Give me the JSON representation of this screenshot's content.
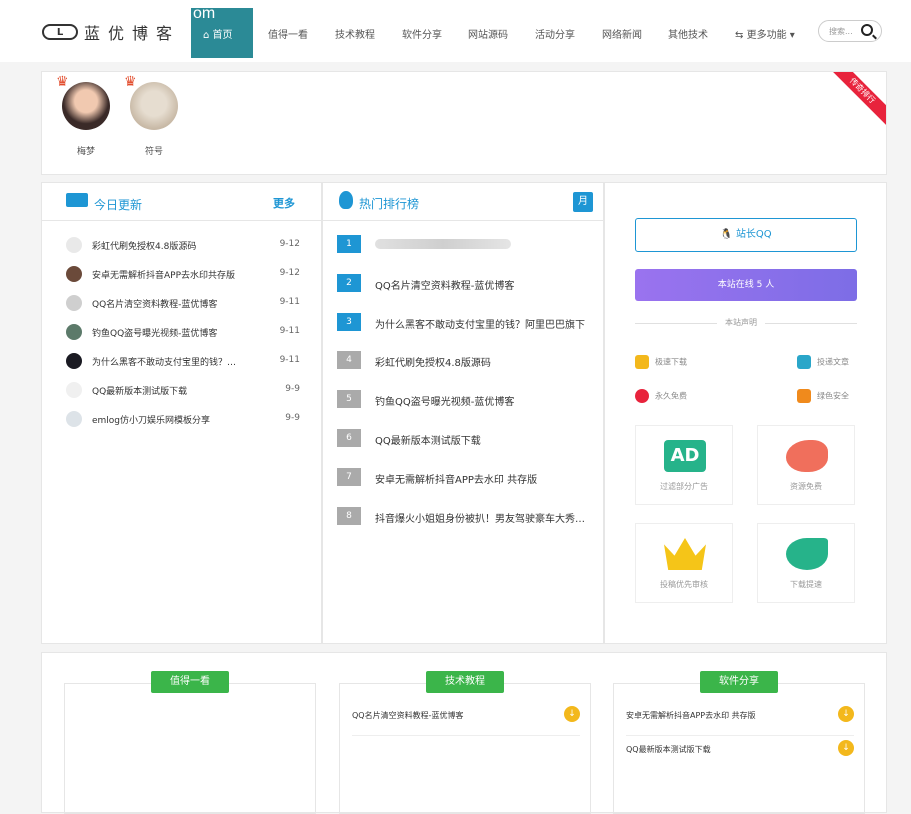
{
  "brand": {
    "mark": "L",
    "name": "蓝优博客",
    "om": "om"
  },
  "nav": {
    "home": "首页",
    "items": [
      "值得一看",
      "技术教程",
      "软件分享",
      "网站源码",
      "活动分享",
      "网络新闻",
      "其他技术",
      "更多功能"
    ],
    "search_placeholder": "搜索..."
  },
  "users": {
    "ribbon": "传奇排行",
    "list": [
      {
        "name": "梅梦"
      },
      {
        "name": "符号"
      }
    ]
  },
  "today": {
    "title": "今日更新",
    "more": "更多",
    "items": [
      {
        "title": "彩虹代刷免授权4.8版源码",
        "date": "9-12"
      },
      {
        "title": "安卓无需解析抖音APP去水印共存版",
        "date": "9-12"
      },
      {
        "title": "QQ名片清空资料教程-蓝优博客",
        "date": "9-11"
      },
      {
        "title": "钓鱼QQ盗号曝光视频-蓝优博客",
        "date": "9-11"
      },
      {
        "title": "为什么黑客不敢动支付宝里的钱？阿里巴巴",
        "date": "9-11"
      },
      {
        "title": "QQ最新版本测试版下载",
        "date": "9-9"
      },
      {
        "title": "emlog仿小刀娱乐网模板分享",
        "date": "9-9"
      }
    ]
  },
  "hot": {
    "title": "热门排行榜",
    "period": "月",
    "items": [
      {
        "rank": "1",
        "title": ""
      },
      {
        "rank": "2",
        "title": "QQ名片清空资料教程-蓝优博客"
      },
      {
        "rank": "3",
        "title": "为什么黑客不敢动支付宝里的钱？阿里巴巴旗下"
      },
      {
        "rank": "4",
        "title": "彩虹代刷免授权4.8版源码"
      },
      {
        "rank": "5",
        "title": "钓鱼QQ盗号曝光视频-蓝优博客"
      },
      {
        "rank": "6",
        "title": "QQ最新版本测试版下载"
      },
      {
        "rank": "7",
        "title": "安卓无需解析抖音APP去水印 共存版"
      },
      {
        "rank": "8",
        "title": "抖音爆火小姐姐身份被扒！男友驾驶豪车大秀恩爱"
      }
    ],
    "colors": {
      "top": "#1e96d4",
      "rest": "#aaaaaa"
    }
  },
  "side": {
    "qq_button": "站长QQ",
    "online": "本站在线 5 人",
    "statement": "本站声明",
    "features": [
      "极速下载",
      "投递文章",
      "永久免费",
      "绿色安全"
    ],
    "tiles": [
      "过滤部分广告",
      "资源免费",
      "投稿优先审核",
      "下载提速"
    ]
  },
  "bottom": {
    "columns": [
      {
        "tag": "值得一看",
        "items": []
      },
      {
        "tag": "技术教程",
        "items": [
          "QQ名片清空资料教程-蓝优博客"
        ]
      },
      {
        "tag": "软件分享",
        "items": [
          "安卓无需解析抖音APP去水印 共存版",
          "QQ最新版本测试版下载"
        ]
      }
    ]
  }
}
